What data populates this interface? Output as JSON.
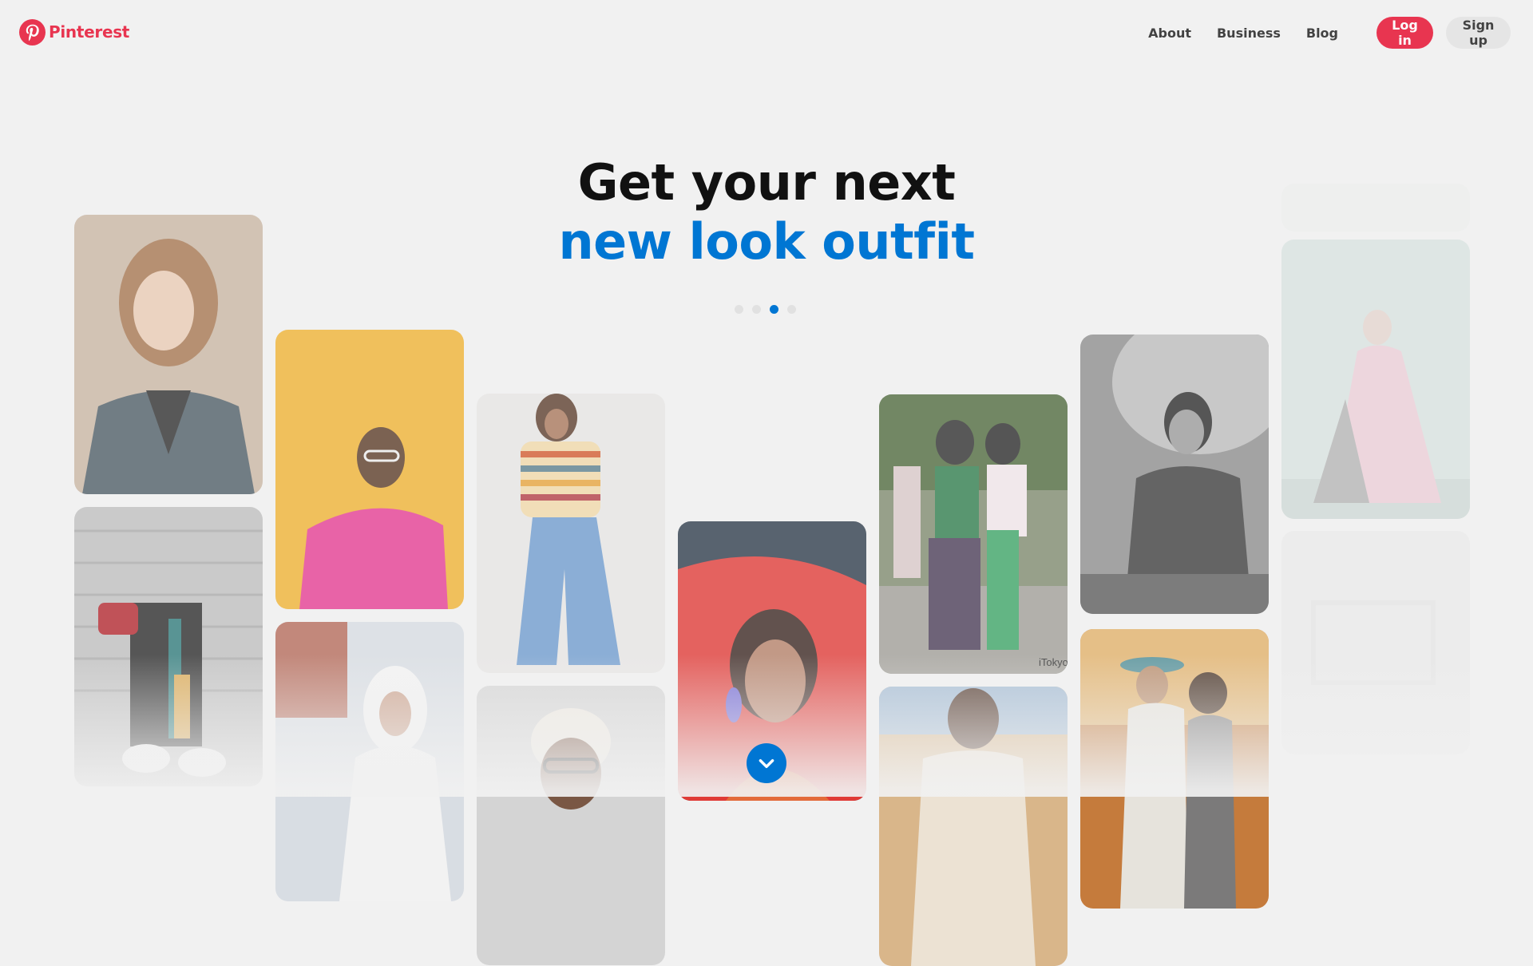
{
  "brand": {
    "name": "Pinterest",
    "accent": "#e60023"
  },
  "nav": {
    "links": [
      "About",
      "Business",
      "Blog"
    ],
    "login_label": "Log in",
    "signup_label": "Sign up"
  },
  "hero": {
    "line1": "Get your next",
    "line2": "new look outfit",
    "line2_color": "#0076d3",
    "carousel_total": 4,
    "carousel_active": 3
  },
  "pins": [
    {
      "desc": "woman-plaid-blazer",
      "icon": "photo"
    },
    {
      "desc": "red-bag-track-pants",
      "icon": "photo"
    },
    {
      "desc": "man-pink-sweater-yellow",
      "icon": "photo"
    },
    {
      "desc": "woman-white-hijab",
      "icon": "photo"
    },
    {
      "desc": "striped-tee-wide-jeans",
      "icon": "photo"
    },
    {
      "desc": "man-grey-hair-glasses",
      "icon": "photo"
    },
    {
      "desc": "woman-red-drape",
      "icon": "photo"
    },
    {
      "desc": "two-girls-street-style",
      "icon": "photo",
      "watermark": "iTokyo"
    },
    {
      "desc": "man-beige-polo",
      "icon": "photo"
    },
    {
      "desc": "man-black-white",
      "icon": "photo"
    },
    {
      "desc": "couple-autumn",
      "icon": "photo"
    },
    {
      "desc": "woman-pink-dress-faded",
      "icon": "photo"
    }
  ],
  "scroll_icon": "chevron-down-icon"
}
